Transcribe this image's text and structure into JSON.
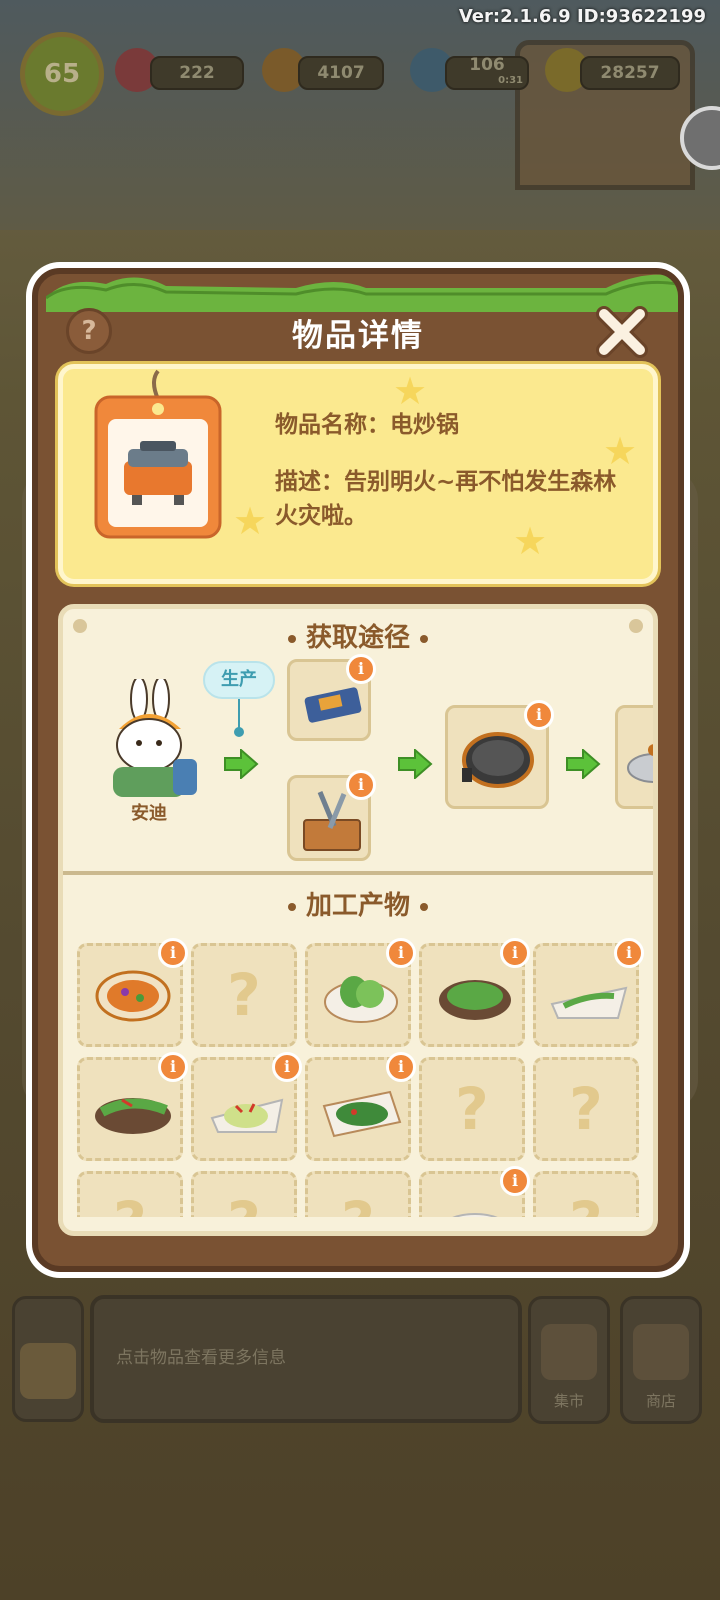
{
  "hud": {
    "level": "65",
    "gems": "222",
    "carrots": "4107",
    "energy": "106",
    "energy_timer": "0:31",
    "coins": "28257",
    "version": "Ver:2.1.6.9 ID:93622199"
  },
  "background": {
    "hint_text": "点击物品查看更多信息",
    "market_label": "集市",
    "shop_label": "商店"
  },
  "modal": {
    "title": "物品详情",
    "help_label": "?",
    "item_name": "物品名称：电炒锅",
    "item_desc": "描述：告别明火~再不怕发生森林火灾啦。",
    "section_source": "获取途径",
    "section_products": "加工产物",
    "character_name": "安迪",
    "produce_label": "生产",
    "info_badge": "i",
    "unknown_mark": "?"
  },
  "product_grid": [
    {
      "dish": "stew-bowl",
      "known": true
    },
    {
      "dish": "unknown",
      "known": false
    },
    {
      "dish": "bok-choy",
      "known": true
    },
    {
      "dish": "greens-plate",
      "known": true
    },
    {
      "dish": "green-beans",
      "known": true
    },
    {
      "dish": "chili-peppers",
      "known": true
    },
    {
      "dish": "stir-fry-cabbage",
      "known": true
    },
    {
      "dish": "pepper-stir-fry",
      "known": true
    },
    {
      "dish": "unknown",
      "known": false
    },
    {
      "dish": "unknown",
      "known": false
    }
  ],
  "colors": {
    "panel_brown": "#7a5233",
    "card_yellow": "#fbe98f",
    "text_brown": "#8a5a2b",
    "badge_orange": "#f0883b",
    "produce_teal": "#3e9db0",
    "arrow_green": "#5cc23a"
  }
}
